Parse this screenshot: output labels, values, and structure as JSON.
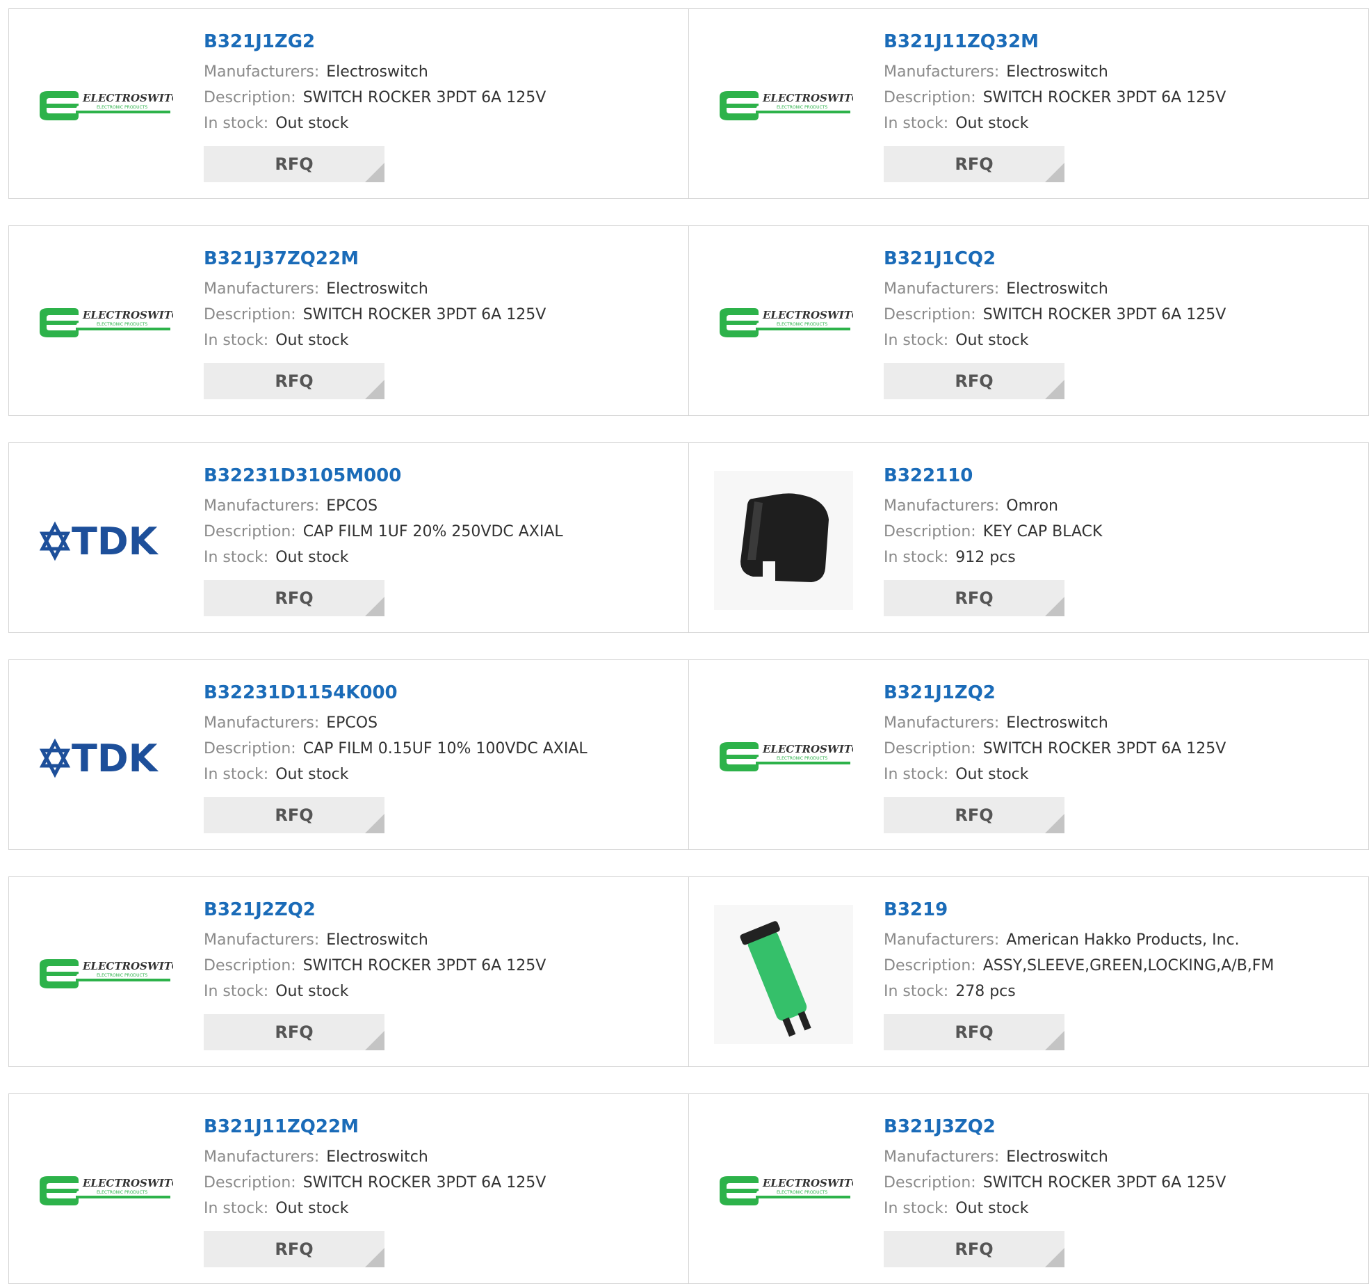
{
  "labels": {
    "manufacturers": "Manufacturers:",
    "description": "Description:",
    "in_stock": "In stock:",
    "rfq": "RFQ"
  },
  "colors": {
    "link": "#1a6bb8",
    "electroswitch_green": "#2db24a",
    "tdk_blue": "#1d4f9a",
    "border": "#d4d4d4",
    "button_bg": "#ececec"
  },
  "logo_text": {
    "electroswitch": "ELECTROSWITCH",
    "electroswitch_sub": "ELECTRONIC PRODUCTS",
    "tdk": "TDK"
  },
  "products": [
    {
      "part": "B321J1ZG2",
      "manufacturer": "Electroswitch",
      "description": "SWITCH ROCKER 3PDT 6A 125V",
      "stock": "Out stock",
      "image": "electroswitch-logo"
    },
    {
      "part": "B321J11ZQ32M",
      "manufacturer": "Electroswitch",
      "description": "SWITCH ROCKER 3PDT 6A 125V",
      "stock": "Out stock",
      "image": "electroswitch-logo"
    },
    {
      "part": "B321J37ZQ22M",
      "manufacturer": "Electroswitch",
      "description": "SWITCH ROCKER 3PDT 6A 125V",
      "stock": "Out stock",
      "image": "electroswitch-logo"
    },
    {
      "part": "B321J1CQ2",
      "manufacturer": "Electroswitch",
      "description": "SWITCH ROCKER 3PDT 6A 125V",
      "stock": "Out stock",
      "image": "electroswitch-logo"
    },
    {
      "part": "B32231D3105M000",
      "manufacturer": "EPCOS",
      "description": "CAP FILM 1UF 20% 250VDC AXIAL",
      "stock": "Out stock",
      "image": "tdk-logo"
    },
    {
      "part": "B322110",
      "manufacturer": "Omron",
      "description": "KEY CAP BLACK",
      "stock": "912 pcs",
      "image": "key-cap-photo"
    },
    {
      "part": "B32231D1154K000",
      "manufacturer": "EPCOS",
      "description": "CAP FILM 0.15UF 10% 100VDC AXIAL",
      "stock": "Out stock",
      "image": "tdk-logo"
    },
    {
      "part": "B321J1ZQ2",
      "manufacturer": "Electroswitch",
      "description": "SWITCH ROCKER 3PDT 6A 125V",
      "stock": "Out stock",
      "image": "electroswitch-logo"
    },
    {
      "part": "B321J2ZQ2",
      "manufacturer": "Electroswitch",
      "description": "SWITCH ROCKER 3PDT 6A 125V",
      "stock": "Out stock",
      "image": "electroswitch-logo"
    },
    {
      "part": "B3219",
      "manufacturer": "American Hakko Products, Inc.",
      "description": "ASSY,SLEEVE,GREEN,LOCKING,A/B,FM",
      "stock": "278 pcs",
      "image": "green-sleeve-photo"
    },
    {
      "part": "B321J11ZQ22M",
      "manufacturer": "Electroswitch",
      "description": "SWITCH ROCKER 3PDT 6A 125V",
      "stock": "Out stock",
      "image": "electroswitch-logo"
    },
    {
      "part": "B321J3ZQ2",
      "manufacturer": "Electroswitch",
      "description": "SWITCH ROCKER 3PDT 6A 125V",
      "stock": "Out stock",
      "image": "electroswitch-logo"
    }
  ]
}
